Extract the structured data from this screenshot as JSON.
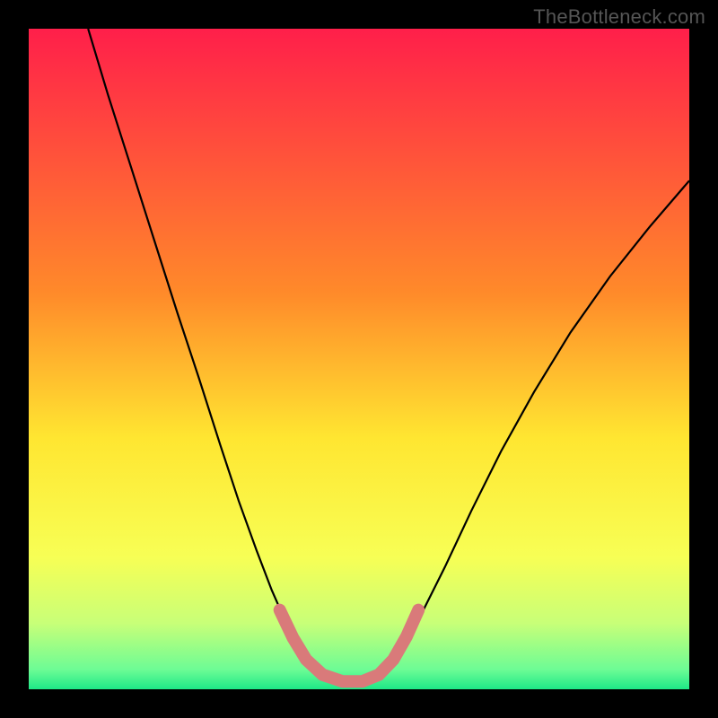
{
  "watermark": "TheBottleneck.com",
  "chart_data": {
    "type": "line",
    "title": "",
    "xlabel": "",
    "ylabel": "",
    "xlim": [
      0,
      1
    ],
    "ylim": [
      0,
      1
    ],
    "background_gradient": {
      "stops": [
        {
          "pos": 0.0,
          "color": "#ff1f4a"
        },
        {
          "pos": 0.4,
          "color": "#ff8a2a"
        },
        {
          "pos": 0.62,
          "color": "#ffe631"
        },
        {
          "pos": 0.8,
          "color": "#f7ff55"
        },
        {
          "pos": 0.9,
          "color": "#c8ff78"
        },
        {
          "pos": 0.97,
          "color": "#6dfc95"
        },
        {
          "pos": 1.0,
          "color": "#1ee887"
        }
      ]
    },
    "series": [
      {
        "name": "bottleneck-curve",
        "note": "V-shaped curve; x normalized 0-1, y normalized 0-1 (0=bottom)",
        "points": [
          {
            "x": 0.09,
            "y": 1.0
          },
          {
            "x": 0.12,
            "y": 0.9
          },
          {
            "x": 0.155,
            "y": 0.79
          },
          {
            "x": 0.19,
            "y": 0.68
          },
          {
            "x": 0.225,
            "y": 0.57
          },
          {
            "x": 0.258,
            "y": 0.47
          },
          {
            "x": 0.29,
            "y": 0.37
          },
          {
            "x": 0.318,
            "y": 0.285
          },
          {
            "x": 0.345,
            "y": 0.21
          },
          {
            "x": 0.368,
            "y": 0.15
          },
          {
            "x": 0.39,
            "y": 0.1
          },
          {
            "x": 0.41,
            "y": 0.06
          },
          {
            "x": 0.43,
            "y": 0.032
          },
          {
            "x": 0.455,
            "y": 0.015
          },
          {
            "x": 0.485,
            "y": 0.01
          },
          {
            "x": 0.515,
            "y": 0.012
          },
          {
            "x": 0.54,
            "y": 0.028
          },
          {
            "x": 0.565,
            "y": 0.06
          },
          {
            "x": 0.595,
            "y": 0.115
          },
          {
            "x": 0.63,
            "y": 0.185
          },
          {
            "x": 0.67,
            "y": 0.27
          },
          {
            "x": 0.715,
            "y": 0.36
          },
          {
            "x": 0.765,
            "y": 0.45
          },
          {
            "x": 0.82,
            "y": 0.54
          },
          {
            "x": 0.88,
            "y": 0.625
          },
          {
            "x": 0.94,
            "y": 0.7
          },
          {
            "x": 1.0,
            "y": 0.77
          }
        ]
      },
      {
        "name": "highlight-segment",
        "note": "thick salmon overlay near curve bottom",
        "color": "#d97a7a",
        "points": [
          {
            "x": 0.38,
            "y": 0.12
          },
          {
            "x": 0.4,
            "y": 0.078
          },
          {
            "x": 0.42,
            "y": 0.045
          },
          {
            "x": 0.445,
            "y": 0.022
          },
          {
            "x": 0.475,
            "y": 0.012
          },
          {
            "x": 0.505,
            "y": 0.012
          },
          {
            "x": 0.53,
            "y": 0.022
          },
          {
            "x": 0.552,
            "y": 0.045
          },
          {
            "x": 0.572,
            "y": 0.08
          },
          {
            "x": 0.59,
            "y": 0.12
          }
        ]
      }
    ]
  }
}
